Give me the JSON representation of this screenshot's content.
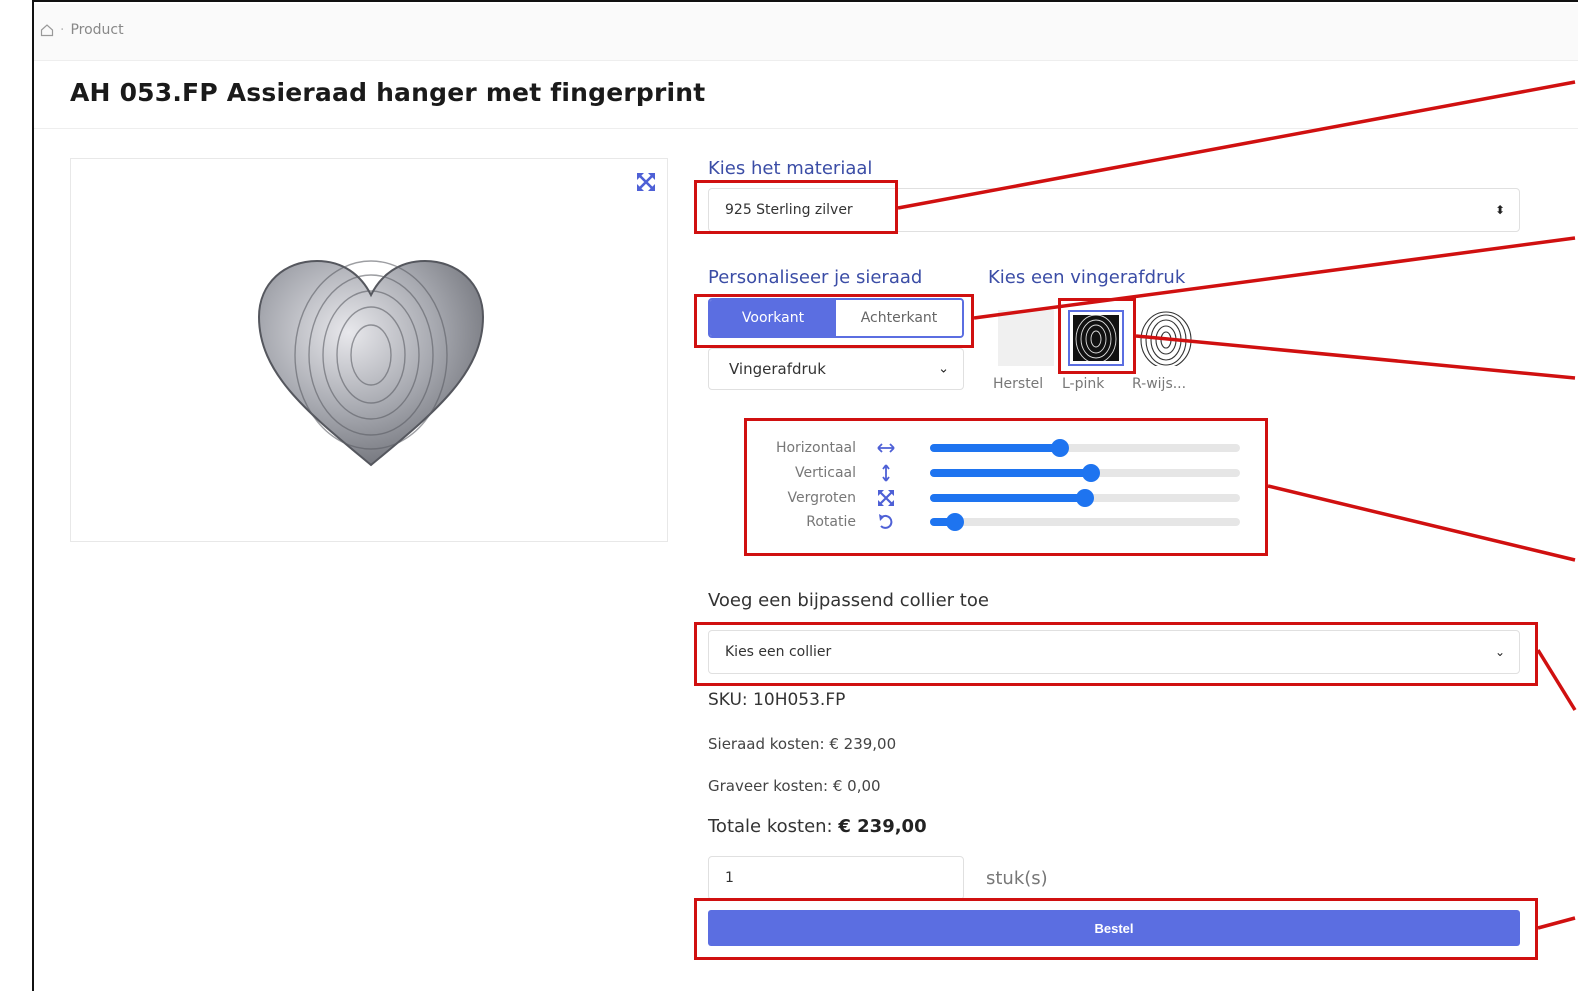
{
  "breadcrumb": {
    "current": "Product"
  },
  "page_title": "AH 053.FP Assieraad hanger met fingerprint",
  "material": {
    "label": "Kies het materiaal",
    "selected": "925 Sterling zilver"
  },
  "personalize": {
    "label": "Personaliseer je sieraad",
    "tabs": [
      "Voorkant",
      "Achterkant"
    ],
    "active_tab": "Voorkant",
    "type_selected": "Vingerafdruk"
  },
  "fingerprint": {
    "label": "Kies een vingerafdruk",
    "options": [
      "Herstel",
      "L-pink",
      "R-wijs..."
    ],
    "selected": "L-pink"
  },
  "sliders": [
    {
      "label": "Horizontaal",
      "icon": "arrows-horizontal-icon",
      "value": 0.42
    },
    {
      "label": "Verticaal",
      "icon": "arrows-vertical-icon",
      "value": 0.52
    },
    {
      "label": "Vergroten",
      "icon": "expand-icon",
      "value": 0.5
    },
    {
      "label": "Rotatie",
      "icon": "rotate-icon",
      "value": 0.08
    }
  ],
  "collier": {
    "label": "Voeg een bijpassend collier toe",
    "selected": "Kies een collier"
  },
  "sku": "SKU: 10H053.FP",
  "costs": {
    "jewelry": "Sieraad kosten: € 239,00",
    "engraving": "Graveer kosten: € 0,00",
    "total_label": "Totale kosten:",
    "total_value": "€ 239,00"
  },
  "quantity": {
    "value": "1",
    "unit": "stuk(s)"
  },
  "order_button": "Bestel",
  "colors": {
    "accent": "#5b6ee1",
    "slider": "#1e74f0",
    "annotation": "#d01010",
    "label": "#3b4da6"
  }
}
